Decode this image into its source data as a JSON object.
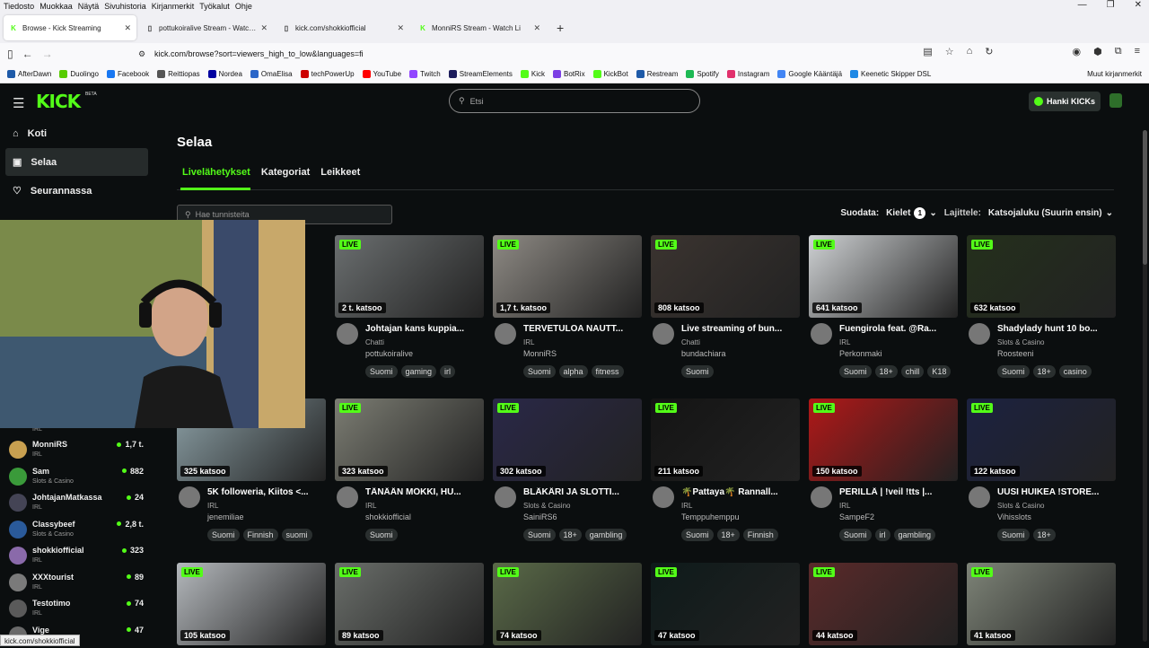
{
  "menu": [
    "Tiedosto",
    "Muokkaa",
    "Näytä",
    "Sivuhistoria",
    "Kirjanmerkit",
    "Työkalut",
    "Ohje"
  ],
  "tabs": [
    {
      "title": "Browse - Kick Streaming",
      "active": true
    },
    {
      "title": "pottukoiralive Stream - Watch Li"
    },
    {
      "title": "kick.com/shokkiofficial"
    },
    {
      "title": "MonniRS Stream - Watch Li"
    }
  ],
  "url": "kick.com/browse?sort=viewers_high_to_low&languages=fi",
  "bookmarks": [
    {
      "label": "AfterDawn",
      "color": "#1e5aa8"
    },
    {
      "label": "Duolingo",
      "color": "#58cc02"
    },
    {
      "label": "Facebook",
      "color": "#1877f2"
    },
    {
      "label": "Reittiopas",
      "color": "#555"
    },
    {
      "label": "Nordea",
      "color": "#0000a0"
    },
    {
      "label": "OmaElisa",
      "color": "#2b66c8"
    },
    {
      "label": "techPowerUp",
      "color": "#c00"
    },
    {
      "label": "YouTube",
      "color": "#f00"
    },
    {
      "label": "Twitch",
      "color": "#9146ff"
    },
    {
      "label": "StreamElements",
      "color": "#1c1c5c"
    },
    {
      "label": "Kick",
      "color": "#53fc18"
    },
    {
      "label": "BotRix",
      "color": "#7b3fe4"
    },
    {
      "label": "KickBot",
      "color": "#53fc18"
    },
    {
      "label": "Restream",
      "color": "#1e5aa8"
    },
    {
      "label": "Spotify",
      "color": "#1db954"
    },
    {
      "label": "Instagram",
      "color": "#e1306c"
    },
    {
      "label": "Google Kääntäjä",
      "color": "#4285f4"
    },
    {
      "label": "Keenetic Skipper DSL",
      "color": "#1e88e5"
    }
  ],
  "other_bookmarks": "Muut kirjanmerkit",
  "site": {
    "logo": "KICK",
    "beta": "BETA",
    "search_placeholder": "Etsi",
    "kicks_button": "Hanki KICKs"
  },
  "nav": {
    "home": "Koti",
    "browse": "Selaa",
    "following": "Seurannassa"
  },
  "sidebar_channels": [
    {
      "name": "MonniRS",
      "cat": "IRL",
      "viewers": "1,7 t."
    },
    {
      "name": "Sam",
      "cat": "Slots & Casino",
      "viewers": "882"
    },
    {
      "name": "JohtajanMatkassa",
      "cat": "IRL",
      "viewers": "24"
    },
    {
      "name": "Classybeef",
      "cat": "Slots & Casino",
      "viewers": "2,8 t."
    },
    {
      "name": "shokkiofficial",
      "cat": "IRL",
      "viewers": "323"
    },
    {
      "name": "XXXtourist",
      "cat": "IRL",
      "viewers": "89"
    },
    {
      "name": "Testotimo",
      "cat": "IRL",
      "viewers": "74"
    },
    {
      "name": "Vige",
      "cat": "",
      "viewers": "47"
    }
  ],
  "sidebar_partial_cat": "IRL",
  "status_url": "kick.com/shokkiofficial",
  "page": {
    "heading": "Selaa",
    "tabs": [
      "Livelähetykset",
      "Kategoriat",
      "Leikkeet"
    ],
    "tag_placeholder": "Hae tunnisteita",
    "filter_label": "Suodata:",
    "languages": "Kielet",
    "lang_count": "1",
    "sort_label": "Lajittele:",
    "sort_value": "Katsojaluku (Suurin ensin)"
  },
  "live_label": "LIVE",
  "cards": [
    {
      "viewers": "2 t. katsoo",
      "title": "Johtajan kans kuppia...",
      "cat": "Chatti",
      "name": "pottukoiralive",
      "tags": [
        "Suomi",
        "gaming",
        "irl"
      ],
      "bg": "#6b6f70"
    },
    {
      "viewers": "1,7 t. katsoo",
      "title": "TERVETULOA NAUTT...",
      "cat": "IRL",
      "name": "MonniRS",
      "tags": [
        "Suomi",
        "alpha",
        "fitness"
      ],
      "bg": "#8e8a84"
    },
    {
      "viewers": "808 katsoo",
      "title": "Live streaming of bun...",
      "cat": "Chatti",
      "name": "bundachiara",
      "tags": [
        "Suomi"
      ],
      "bg": "#3b3430"
    },
    {
      "viewers": "641 katsoo",
      "title": "Fuengirola feat. @Ra...",
      "cat": "IRL",
      "name": "Perkonmaki",
      "tags": [
        "Suomi",
        "18+",
        "chill",
        "K18"
      ],
      "bg": "#cfd2d4"
    },
    {
      "viewers": "632 katsoo",
      "title": "Shadylady hunt 10 bo...",
      "cat": "Slots & Casino",
      "name": "Roosteeni",
      "tags": [
        "Suomi",
        "18+",
        "casino"
      ],
      "bg": "#24301c"
    },
    {
      "viewers": "325 katsoo",
      "title": "5K followeria, Kiitos <...",
      "cat": "IRL",
      "name": "jenemiliae",
      "tags": [
        "Suomi",
        "Finnish",
        "suomi"
      ],
      "bg": "#8ca0a6"
    },
    {
      "viewers": "323 katsoo",
      "title": "TÄNÄÄN MÖKKI, HU...",
      "cat": "IRL",
      "name": "shokkiofficial",
      "tags": [
        "Suomi"
      ],
      "bg": "#7c7d73"
    },
    {
      "viewers": "302 katsoo",
      "title": "BLÄKÄRI JA SLOTTI...",
      "cat": "Slots & Casino",
      "name": "SainiRS6",
      "tags": [
        "Suomi",
        "18+",
        "gambling"
      ],
      "bg": "#2a2848"
    },
    {
      "viewers": "211 katsoo",
      "title": "🌴Pattaya🌴 Rannall...",
      "cat": "IRL",
      "name": "Temppuhemppu",
      "tags": [
        "Suomi",
        "18+",
        "Finnish"
      ],
      "bg": "#141414"
    },
    {
      "viewers": "150 katsoo",
      "title": "PERILLÄ | !veil !tts |...",
      "cat": "IRL",
      "name": "SampeF2",
      "tags": [
        "Suomi",
        "irl",
        "gambling"
      ],
      "bg": "#b01818"
    },
    {
      "viewers": "122 katsoo",
      "title": "UUSI HUIKEA !STORE...",
      "cat": "Slots & Casino",
      "name": "Vihisslots",
      "tags": [
        "Suomi",
        "18+"
      ],
      "bg": "#1c2240"
    },
    {
      "viewers": "105 katsoo",
      "bg": "#b4b8bc"
    },
    {
      "viewers": "89 katsoo",
      "bg": "#6a6e6a"
    },
    {
      "viewers": "74 katsoo",
      "bg": "#5a6a48"
    },
    {
      "viewers": "47 katsoo",
      "bg": "#0e1a1a"
    },
    {
      "viewers": "44 katsoo",
      "bg": "#5a2a2a"
    },
    {
      "viewers": "41 katsoo",
      "bg": "#7e8478"
    }
  ]
}
